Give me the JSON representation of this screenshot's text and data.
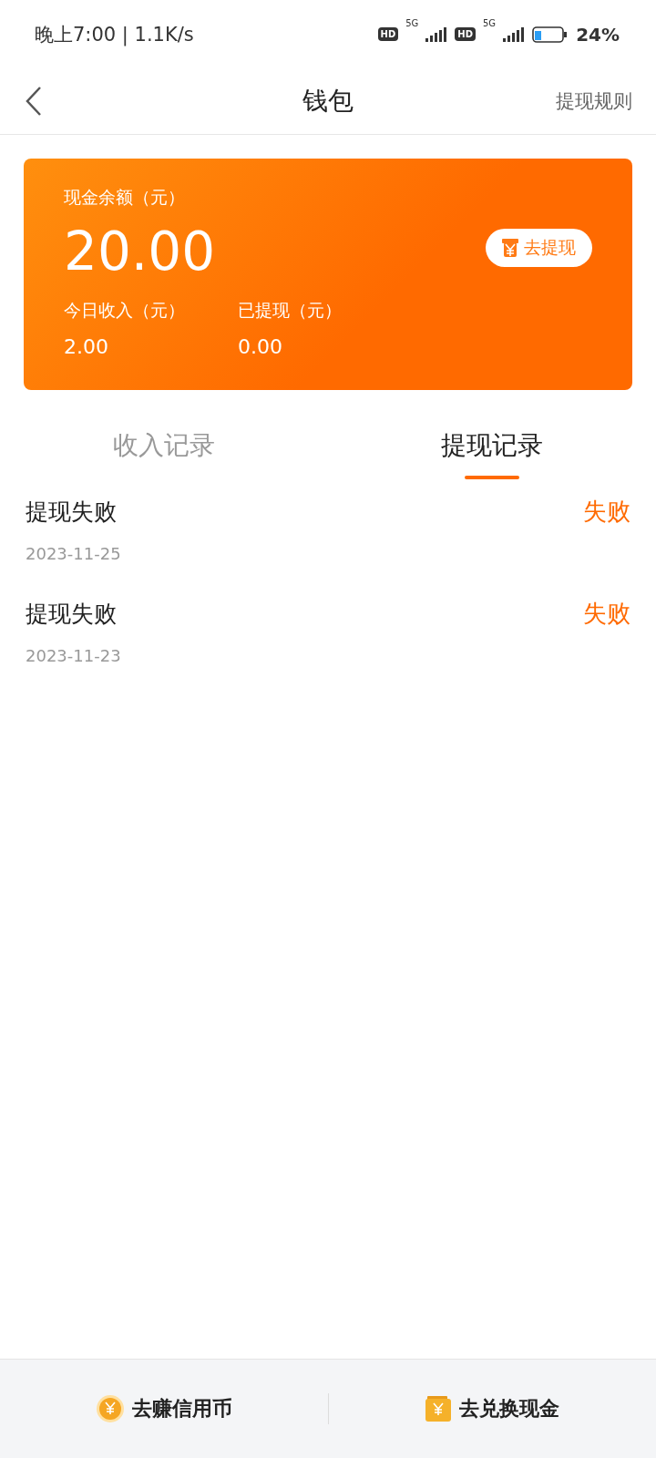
{
  "status_bar": {
    "time": "晚上7:00 | 1.1K/s",
    "sims": [
      {
        "hd": "HD",
        "network": "5G"
      },
      {
        "hd": "HD",
        "network": "5G"
      }
    ],
    "battery": "24%"
  },
  "header": {
    "title": "钱包",
    "action": "提现规则"
  },
  "card": {
    "balance_label": "现金余额（元）",
    "balance": "20.00",
    "withdraw_button": "去提现",
    "stats": [
      {
        "label": "今日收入（元）",
        "value": "2.00"
      },
      {
        "label": "已提现（元）",
        "value": "0.00"
      }
    ]
  },
  "tabs": [
    {
      "label": "收入记录",
      "selected": false
    },
    {
      "label": "提现记录",
      "selected": true
    }
  ],
  "records": [
    {
      "title": "提现失败",
      "date": "2023-11-25",
      "status": "失败"
    },
    {
      "title": "提现失败",
      "date": "2023-11-23",
      "status": "失败"
    }
  ],
  "bottom_bar": [
    {
      "kind": "coin",
      "label": "去赚信用币"
    },
    {
      "kind": "wallet",
      "label": "去兑换现金"
    }
  ]
}
